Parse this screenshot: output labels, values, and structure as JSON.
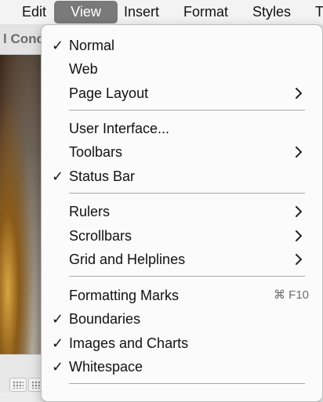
{
  "menubar": {
    "items": [
      {
        "label": "Edit"
      },
      {
        "label": "View"
      },
      {
        "label": "Insert"
      },
      {
        "label": "Format"
      },
      {
        "label": "Styles"
      },
      {
        "label": "T"
      }
    ]
  },
  "document": {
    "tab_title": "l Conc"
  },
  "view_menu": {
    "groups": [
      [
        {
          "label": "Normal",
          "checked": true
        },
        {
          "label": "Web"
        },
        {
          "label": "Page Layout",
          "submenu": true
        }
      ],
      [
        {
          "label": "User Interface..."
        },
        {
          "label": "Toolbars",
          "submenu": true
        },
        {
          "label": "Status Bar",
          "checked": true
        }
      ],
      [
        {
          "label": "Rulers",
          "submenu": true
        },
        {
          "label": "Scrollbars",
          "submenu": true
        },
        {
          "label": "Grid and Helplines",
          "submenu": true
        }
      ],
      [
        {
          "label": "Formatting Marks",
          "shortcut": "⌘ F10"
        },
        {
          "label": "Boundaries",
          "checked": true
        },
        {
          "label": "Images and Charts",
          "checked": true
        },
        {
          "label": "Whitespace",
          "checked": true
        }
      ]
    ],
    "check_glyph": "✓"
  }
}
